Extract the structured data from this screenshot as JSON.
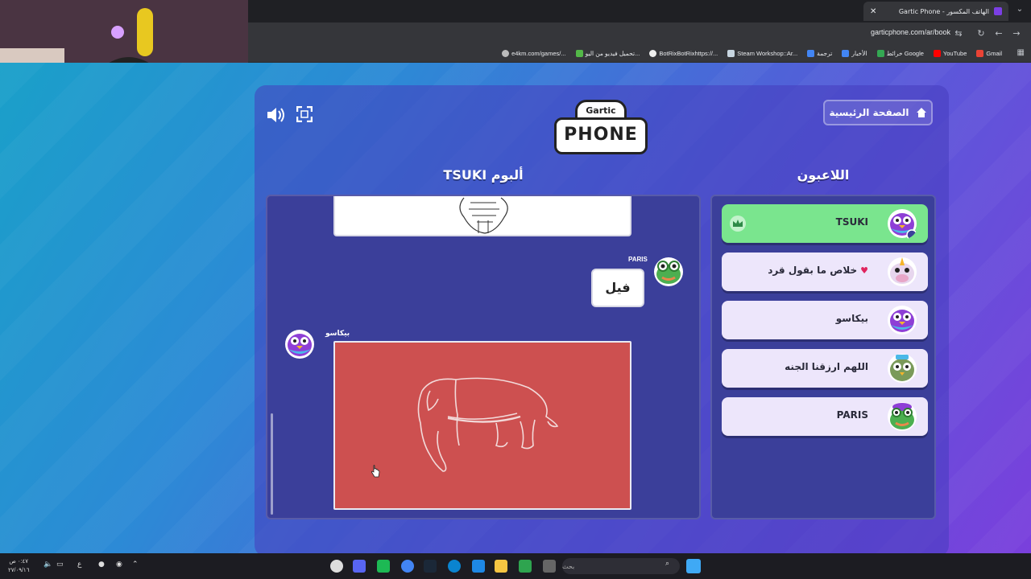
{
  "browser": {
    "tab_title": "الهاتف المكسور - Gartic Phone",
    "url": "garticphone.com/ar/book",
    "bookmarks": [
      {
        "label": "Gmail",
        "color": "#ea4335"
      },
      {
        "label": "YouTube",
        "color": "#ff0000"
      },
      {
        "label": "خرائط Google",
        "color": "#34a853"
      },
      {
        "label": "الأخبار",
        "color": "#4285f4"
      },
      {
        "label": "ترجمة",
        "color": "#4285f4"
      },
      {
        "label": "Steam Workshop::Ar...",
        "color": "#1b2838"
      },
      {
        "label": "BotRixBotRixhttps://...",
        "color": "#333333"
      },
      {
        "label": "تحميل فيديو من اليو...",
        "color": "#53b848"
      },
      {
        "label": "e4km.com/games/...",
        "color": "#888888"
      }
    ]
  },
  "game": {
    "home_label": "الصفحة الرئيسية",
    "logo_top": "Gartic",
    "logo_bottom": "PHONE",
    "album_title": "ألبوم TSUKI",
    "players_title": "اللاعبون",
    "album": {
      "phrase_author": "PARIS",
      "phrase_text": "فيل",
      "drawing_author": "بيكاسو"
    },
    "players": [
      {
        "name": "TSUKI",
        "is_me": true,
        "avatar_color": "#8e3fd6"
      },
      {
        "name": "خلاص ما بقول قرد",
        "is_me": false,
        "avatar_color": "#e7a6c8"
      },
      {
        "name": "بيكاسو",
        "is_me": false,
        "avatar_color": "#8e3fd6"
      },
      {
        "name": "اللهم ارزقنا الجنه",
        "is_me": false,
        "avatar_color": "#7a9a5a"
      },
      {
        "name": "PARIS",
        "is_me": false,
        "avatar_color": "#4caf50"
      }
    ]
  },
  "taskbar": {
    "search_placeholder": "بحث",
    "clock_time": "٠:٤٧ ص",
    "clock_date": "٢٧/٠٩/١٦",
    "lang": "ع"
  },
  "colors": {
    "drawing_bg": "#cd5050",
    "player_me": "#7ae58e",
    "player_row": "#ede6fb",
    "panel": "#3b3f9a"
  }
}
